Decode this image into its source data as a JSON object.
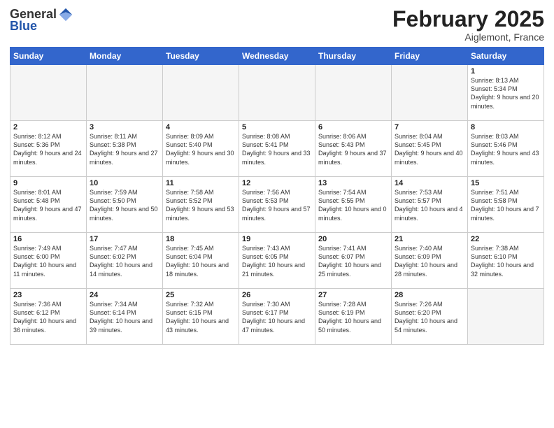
{
  "logo": {
    "general": "General",
    "blue": "Blue"
  },
  "header": {
    "month": "February 2025",
    "location": "Aiglemont, France"
  },
  "weekdays": [
    "Sunday",
    "Monday",
    "Tuesday",
    "Wednesday",
    "Thursday",
    "Friday",
    "Saturday"
  ],
  "weeks": [
    [
      {
        "day": "",
        "info": ""
      },
      {
        "day": "",
        "info": ""
      },
      {
        "day": "",
        "info": ""
      },
      {
        "day": "",
        "info": ""
      },
      {
        "day": "",
        "info": ""
      },
      {
        "day": "",
        "info": ""
      },
      {
        "day": "1",
        "info": "Sunrise: 8:13 AM\nSunset: 5:34 PM\nDaylight: 9 hours and 20 minutes."
      }
    ],
    [
      {
        "day": "2",
        "info": "Sunrise: 8:12 AM\nSunset: 5:36 PM\nDaylight: 9 hours and 24 minutes."
      },
      {
        "day": "3",
        "info": "Sunrise: 8:11 AM\nSunset: 5:38 PM\nDaylight: 9 hours and 27 minutes."
      },
      {
        "day": "4",
        "info": "Sunrise: 8:09 AM\nSunset: 5:40 PM\nDaylight: 9 hours and 30 minutes."
      },
      {
        "day": "5",
        "info": "Sunrise: 8:08 AM\nSunset: 5:41 PM\nDaylight: 9 hours and 33 minutes."
      },
      {
        "day": "6",
        "info": "Sunrise: 8:06 AM\nSunset: 5:43 PM\nDaylight: 9 hours and 37 minutes."
      },
      {
        "day": "7",
        "info": "Sunrise: 8:04 AM\nSunset: 5:45 PM\nDaylight: 9 hours and 40 minutes."
      },
      {
        "day": "8",
        "info": "Sunrise: 8:03 AM\nSunset: 5:46 PM\nDaylight: 9 hours and 43 minutes."
      }
    ],
    [
      {
        "day": "9",
        "info": "Sunrise: 8:01 AM\nSunset: 5:48 PM\nDaylight: 9 hours and 47 minutes."
      },
      {
        "day": "10",
        "info": "Sunrise: 7:59 AM\nSunset: 5:50 PM\nDaylight: 9 hours and 50 minutes."
      },
      {
        "day": "11",
        "info": "Sunrise: 7:58 AM\nSunset: 5:52 PM\nDaylight: 9 hours and 53 minutes."
      },
      {
        "day": "12",
        "info": "Sunrise: 7:56 AM\nSunset: 5:53 PM\nDaylight: 9 hours and 57 minutes."
      },
      {
        "day": "13",
        "info": "Sunrise: 7:54 AM\nSunset: 5:55 PM\nDaylight: 10 hours and 0 minutes."
      },
      {
        "day": "14",
        "info": "Sunrise: 7:53 AM\nSunset: 5:57 PM\nDaylight: 10 hours and 4 minutes."
      },
      {
        "day": "15",
        "info": "Sunrise: 7:51 AM\nSunset: 5:58 PM\nDaylight: 10 hours and 7 minutes."
      }
    ],
    [
      {
        "day": "16",
        "info": "Sunrise: 7:49 AM\nSunset: 6:00 PM\nDaylight: 10 hours and 11 minutes."
      },
      {
        "day": "17",
        "info": "Sunrise: 7:47 AM\nSunset: 6:02 PM\nDaylight: 10 hours and 14 minutes."
      },
      {
        "day": "18",
        "info": "Sunrise: 7:45 AM\nSunset: 6:04 PM\nDaylight: 10 hours and 18 minutes."
      },
      {
        "day": "19",
        "info": "Sunrise: 7:43 AM\nSunset: 6:05 PM\nDaylight: 10 hours and 21 minutes."
      },
      {
        "day": "20",
        "info": "Sunrise: 7:41 AM\nSunset: 6:07 PM\nDaylight: 10 hours and 25 minutes."
      },
      {
        "day": "21",
        "info": "Sunrise: 7:40 AM\nSunset: 6:09 PM\nDaylight: 10 hours and 28 minutes."
      },
      {
        "day": "22",
        "info": "Sunrise: 7:38 AM\nSunset: 6:10 PM\nDaylight: 10 hours and 32 minutes."
      }
    ],
    [
      {
        "day": "23",
        "info": "Sunrise: 7:36 AM\nSunset: 6:12 PM\nDaylight: 10 hours and 36 minutes."
      },
      {
        "day": "24",
        "info": "Sunrise: 7:34 AM\nSunset: 6:14 PM\nDaylight: 10 hours and 39 minutes."
      },
      {
        "day": "25",
        "info": "Sunrise: 7:32 AM\nSunset: 6:15 PM\nDaylight: 10 hours and 43 minutes."
      },
      {
        "day": "26",
        "info": "Sunrise: 7:30 AM\nSunset: 6:17 PM\nDaylight: 10 hours and 47 minutes."
      },
      {
        "day": "27",
        "info": "Sunrise: 7:28 AM\nSunset: 6:19 PM\nDaylight: 10 hours and 50 minutes."
      },
      {
        "day": "28",
        "info": "Sunrise: 7:26 AM\nSunset: 6:20 PM\nDaylight: 10 hours and 54 minutes."
      },
      {
        "day": "",
        "info": ""
      }
    ]
  ]
}
